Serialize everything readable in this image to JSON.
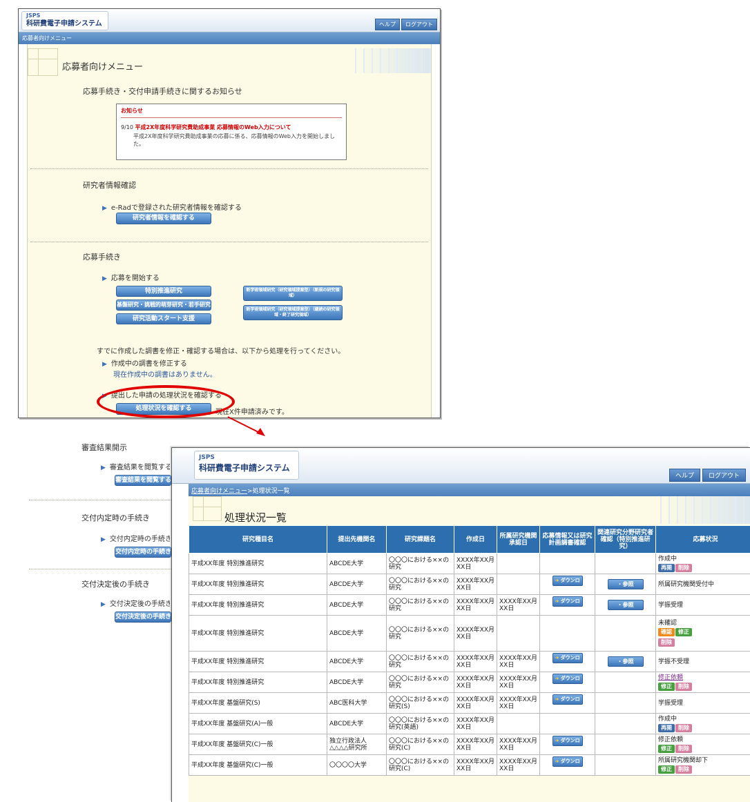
{
  "app": {
    "org": "JSPS",
    "title": "科研費電子申請システム",
    "help_label": "ヘルプ",
    "logout_label": "ログアウト"
  },
  "menu_window": {
    "breadcrumb": "応募者向けメニュー",
    "page_title": "応募者向けメニュー",
    "notice_section_title": "応募手続き・交付申請手続きに関するお知らせ",
    "notice": {
      "header": "お知らせ",
      "date": "9/10",
      "link_text": "平成2X年度科学研究費助成事業 応募情報のWeb入力について",
      "body": "平成2X年度科学研究費助成事業の応募に係る、応募情報のWeb入力を開始しました。"
    },
    "researcher_section": {
      "title": "研究者情報確認",
      "item": "e-Radで登録された研究者情報を確認する",
      "button": "研究者情報を確認する"
    },
    "apply_section": {
      "title": "応募手続き",
      "start_item": "応募を開始する",
      "buttons": [
        "特別推進研究",
        "基盤研究・挑戦的萌芽研究・若手研究",
        "研究活動スタート支援"
      ],
      "right_buttons": [
        "新学術領域研究（研究領域提案型）（新規の研究領域）",
        "新学術領域研究（研究領域提案型）（継続の研究領域・終了研究領域）"
      ],
      "modify_note": "すでに作成した調書を修正・確認する場合は、以下から処理を行ってください。",
      "modify_item": "作成中の調書を修正する",
      "no_docs_text": "現在作成中の調書はありません。",
      "status_item": "提出した申請の処理状況を確認する",
      "status_button": "処理状況を確認する",
      "status_count_text": "現在X件申請済みです。"
    },
    "review_section": {
      "title": "審査結果開示",
      "item": "審査結果を閲覧する",
      "button": "審査結果を閲覧する"
    },
    "grant_decision_section": {
      "title": "交付内定時の手続き",
      "item": "交付内定時の手続きを行う",
      "button": "交付内定時の手続きを行う"
    },
    "post_decision_section": {
      "title": "交付決定後の手続き",
      "item": "交付決定後の手続きを行う",
      "button": "交付決定後の手続きを行う"
    }
  },
  "status_window": {
    "breadcrumb_link": "応募者向けメニュー",
    "breadcrumb_current": "処理状況一覧",
    "page_title": "処理状況一覧",
    "download_label": "ダウンロード",
    "reference_label": "参照",
    "columns": [
      "研究種目名",
      "提出先機関名",
      "研究課題名",
      "作成日",
      "所属研究機関承認日",
      "応募情報又は研究計画調書確認",
      "関連研究分野研究者確認（特別推進研究）",
      "応募状況"
    ],
    "rows": [
      {
        "kind": "平成XX年度 特別推進研究",
        "inst": "ABCDE大学",
        "topic": "〇〇〇における××の研究",
        "created": "XXXX年XX月XX日",
        "approved": "",
        "download": false,
        "reference": false,
        "status": "作成中",
        "actions": [
          "再開",
          "削除"
        ]
      },
      {
        "kind": "平成XX年度 特別推進研究",
        "inst": "ABCDE大学",
        "topic": "〇〇〇における××の研究",
        "created": "XXXX年XX月XX日",
        "approved": "",
        "download": true,
        "reference": true,
        "status": "所属研究機関受付中",
        "actions": []
      },
      {
        "kind": "平成XX年度 特別推進研究",
        "inst": "ABCDE大学",
        "topic": "〇〇〇における××の研究",
        "created": "XXXX年XX月XX日",
        "approved": "XXXX年XX月XX日",
        "download": true,
        "reference": true,
        "status": "学振受理",
        "actions": []
      },
      {
        "kind": "平成XX年度 特別推進研究",
        "inst": "ABCDE大学",
        "topic": "〇〇〇における××の研究",
        "created": "XXXX年XX月XX日",
        "approved": "",
        "download": false,
        "reference": false,
        "status": "未確認",
        "actions": [
          "確認",
          "修正",
          "削除"
        ]
      },
      {
        "kind": "平成XX年度 特別推進研究",
        "inst": "ABCDE大学",
        "topic": "〇〇〇における××の研究",
        "created": "XXXX年XX月XX日",
        "approved": "XXXX年XX月XX日",
        "download": true,
        "reference": true,
        "status": "学振不受理",
        "actions": []
      },
      {
        "kind": "平成XX年度 特別推進研究",
        "inst": "ABCDE大学",
        "topic": "〇〇〇における××の研究",
        "created": "XXXX年XX月XX日",
        "approved": "XXXX年XX月XX日",
        "download": true,
        "reference": false,
        "status": "修正依頼",
        "status_link": true,
        "actions": [
          "修正",
          "削除"
        ]
      },
      {
        "kind": "平成XX年度 基盤研究(S)",
        "inst": "ABC医科大学",
        "topic": "〇〇〇における××の研究(S)",
        "created": "XXXX年XX月XX日",
        "approved": "XXXX年XX月XX日",
        "download": true,
        "reference": false,
        "status": "学振受理",
        "actions": []
      },
      {
        "kind": "平成XX年度 基盤研究(A)一般",
        "inst": "ABCDE大学",
        "topic": "〇〇〇における××の研究(英語)",
        "created": "XXXX年XX月XX日",
        "approved": "",
        "download": false,
        "reference": false,
        "status": "作成中",
        "actions": [
          "再開",
          "削除"
        ]
      },
      {
        "kind": "平成XX年度 基盤研究(C)一般",
        "inst": "独立行政法人△△△△研究所",
        "topic": "〇〇〇における××の研究(C)",
        "created": "XXXX年XX月XX日",
        "approved": "XXXX年XX月XX日",
        "download": true,
        "reference": false,
        "status": "修正依頼",
        "actions": [
          "修正",
          "削除"
        ]
      },
      {
        "kind": "平成XX年度 基盤研究(C)一般",
        "inst": "〇〇〇〇大学",
        "topic": "〇〇〇における××の研究(C)",
        "created": "XXXX年XX月XX日",
        "approved": "XXXX年XX月XX日",
        "download": true,
        "reference": false,
        "status": "所属研究機関却下",
        "actions": [
          "修正",
          "削除"
        ]
      }
    ]
  },
  "colors": {
    "header_blue": "#2d6fae",
    "highlight_red": "#e00000",
    "content_bg": "#fdfbe5"
  }
}
